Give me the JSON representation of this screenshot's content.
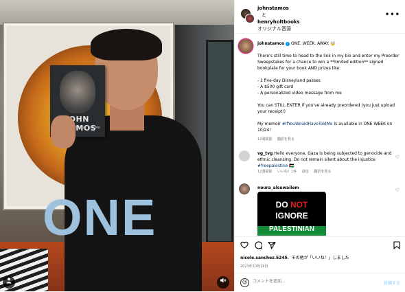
{
  "header": {
    "user1": "johnstamos",
    "connector": "と",
    "user2": "henryholtbooks",
    "subtitle": "オリジナル音源",
    "more_icon": "more-horizontal-icon"
  },
  "media": {
    "overlay_text": "ONE",
    "book_title": "JOHN STAMOS",
    "book_subtitle": "If You Would Have Told Me",
    "user_tag_icon": "person-icon",
    "mute_icon": "speaker-muted-icon"
  },
  "caption": {
    "username": "johnstamos",
    "headline": "ONE. WEEK. AWAY. 🤯",
    "para1": "There's still time to head to the link in my bio and enter my Preorder Sweepstakes for a chance to win a **limited edition** signed bookplate for your book AND prizes like:",
    "list": [
      "- 2 five-day Disneyland passes",
      "- A $500 gift card",
      "- A personalized video message from me"
    ],
    "para2": "You can STILL ENTER if you've already preordered (you just upload your receipt!)",
    "para3_pre": "My memoir ",
    "para3_link": "#IfYouWouldHaveToldMe",
    "para3_post": " is available in ONE WEEK on 10/24!",
    "time": "12週間前",
    "translate": "翻訳を見る"
  },
  "comments": [
    {
      "username": "vg_tvg",
      "text": "Hello everyone, Gaza is being subjected to genocide and ethnic cleansing. Do not remain silent about the injustice ",
      "tag": "#freepalestine",
      "emoji": "🇵🇸",
      "time": "12週間前",
      "likes": "いいね！1件",
      "reply": "返信",
      "translate": "翻訳を見る"
    },
    {
      "username": "noura_alsuwailem",
      "image_line1_a": "DO ",
      "image_line1_b": "NOT",
      "image_line2": "IGNORE",
      "image_line3": "PALESTINIAN"
    }
  ],
  "actions": {
    "like_icon": "heart-icon",
    "comment_icon": "comment-icon",
    "share_icon": "paper-plane-icon",
    "save_icon": "bookmark-icon"
  },
  "likes_line": {
    "user": "nicole.sanchez.5245",
    "rest": "、その他が「いいね！」しました"
  },
  "date": "2023年10月18日",
  "comment_bar": {
    "placeholder": "コメントを追加...",
    "post": "投稿する"
  },
  "colors": {
    "link": "#00376b",
    "verified": "#0095f6",
    "overlay_text": "#9ec1dd",
    "post_disabled": "#b2dffc"
  }
}
